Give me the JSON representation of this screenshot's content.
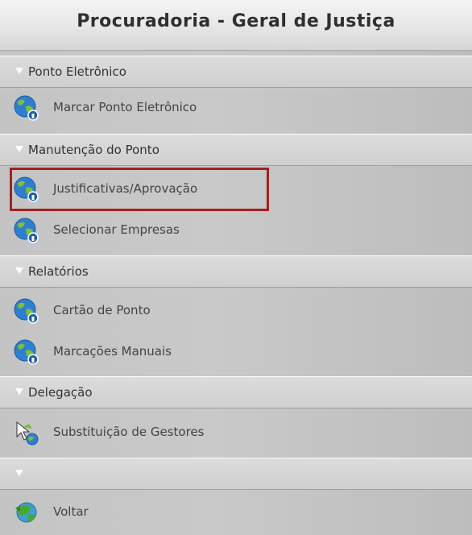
{
  "header": {
    "title": "Procuradoria - Geral de Justiça"
  },
  "sections": [
    {
      "label": "Ponto Eletrônico",
      "items": [
        {
          "label": "Marcar Ponto Eletrônico",
          "icon": "globe-icon"
        }
      ]
    },
    {
      "label": "Manutenção do Ponto",
      "items": [
        {
          "label": "Justificativas/Aprovação",
          "icon": "globe-icon",
          "highlighted": true
        },
        {
          "label": "Selecionar Empresas",
          "icon": "globe-icon"
        }
      ]
    },
    {
      "label": "Relatórios",
      "items": [
        {
          "label": "Cartão de Ponto",
          "icon": "globe-icon"
        },
        {
          "label": "Marcações Manuais",
          "icon": "globe-icon"
        }
      ]
    },
    {
      "label": "Delegação",
      "items": [
        {
          "label": "Substituição de Gestores",
          "icon": "cursor-globe-icon"
        }
      ]
    },
    {
      "label": "",
      "items": [
        {
          "label": "Voltar",
          "icon": "green-globe-icon"
        }
      ]
    }
  ],
  "colors": {
    "highlight": "#a32020",
    "globe": "#2f7fd0",
    "globe_land": "#7dbf3a"
  }
}
